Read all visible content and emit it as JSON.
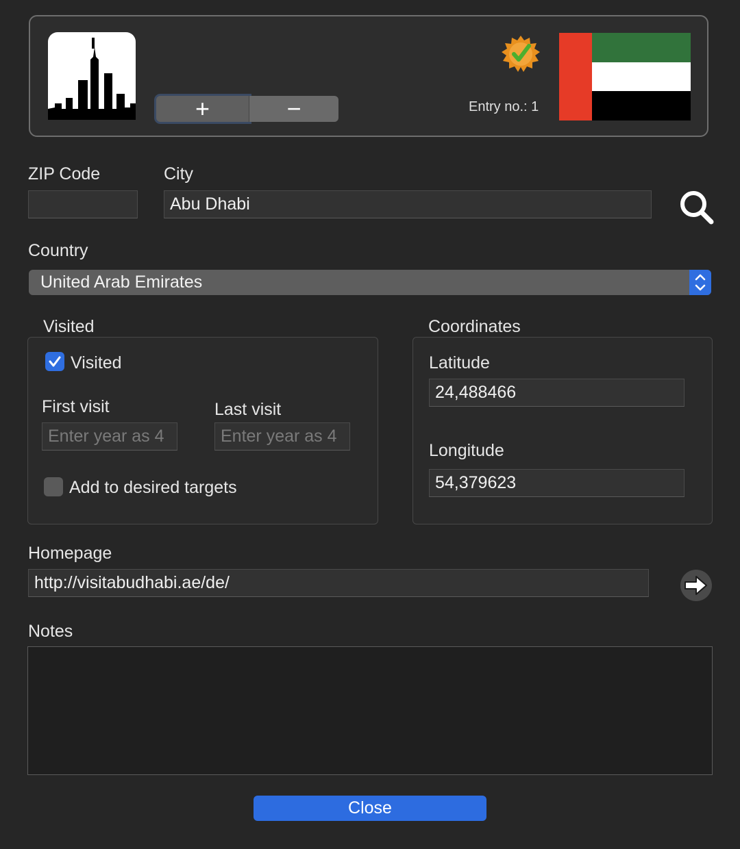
{
  "header": {
    "plus_label": "+",
    "minus_label": "−",
    "entry_label": "Entry no.: 1",
    "flag_colors": {
      "hoist": "#e63b27",
      "top": "#31733b",
      "middle": "#ffffff",
      "bottom": "#000000"
    }
  },
  "location": {
    "zip_label": "ZIP Code",
    "zip_value": "",
    "city_label": "City",
    "city_value": "Abu Dhabi"
  },
  "country": {
    "label": "Country",
    "selected": "United Arab Emirates"
  },
  "visited": {
    "group_title": "Visited",
    "checkbox_label": "Visited",
    "checked": true,
    "first_visit_label": "First visit",
    "first_visit_placeholder": "Enter year as 4",
    "last_visit_label": "Last visit",
    "last_visit_placeholder": "Enter year as 4",
    "targets_label": "Add to desired targets",
    "targets_checked": false
  },
  "coordinates": {
    "group_title": "Coordinates",
    "latitude_label": "Latitude",
    "latitude_value": "24,488466",
    "longitude_label": "Longitude",
    "longitude_value": "54,379623"
  },
  "homepage": {
    "label": "Homepage",
    "value": "http://visitabudhabi.ae/de/"
  },
  "notes": {
    "label": "Notes",
    "value": ""
  },
  "actions": {
    "close_label": "Close"
  },
  "colors": {
    "accent": "#2f6ee0",
    "background": "#262626"
  }
}
